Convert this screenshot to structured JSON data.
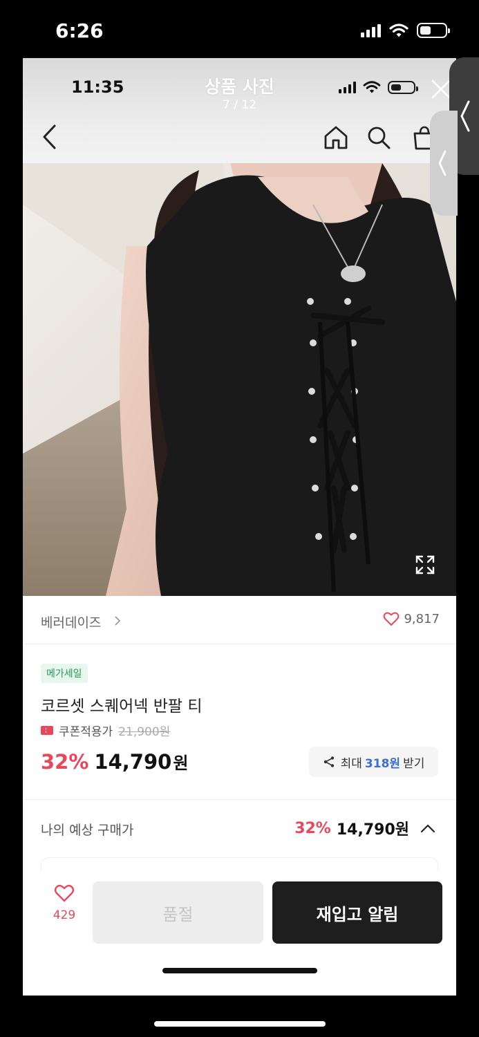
{
  "outer_status": {
    "time": "6:26",
    "icons": [
      "signal-icon",
      "wifi-icon",
      "battery-icon"
    ]
  },
  "inner_status": {
    "time": "11:35",
    "icons": [
      "signal-icon",
      "wifi-icon",
      "battery-icon"
    ]
  },
  "viewer": {
    "title": "상품 사진",
    "counter": "7 / 12"
  },
  "nav": {
    "icons": [
      "back-chevron-icon",
      "home-icon",
      "search-icon",
      "shopping-bag-icon"
    ]
  },
  "photo": {
    "description_icon": "expand-icon"
  },
  "brand": {
    "name": "베러데이즈",
    "chevron": ">",
    "likes": "9,817"
  },
  "product": {
    "badge": "메가세일",
    "name": "코르셋 스퀘어넥 반팔 티",
    "coupon_label": "쿠폰적용가",
    "original_price": "21,900원",
    "discount": "32%",
    "price": "14,790",
    "currency": "원"
  },
  "share": {
    "prefix": "최대",
    "amount": "318원",
    "suffix": "받기"
  },
  "expected": {
    "label": "나의 예상 구매가",
    "discount": "32%",
    "price": "14,790원"
  },
  "bottom": {
    "wish_count": "429",
    "soldout_label": "품절",
    "restock_label": "재입고 알림"
  },
  "colors": {
    "accent_red": "#e8485c",
    "badge_green": "#1f9a55",
    "share_blue": "#3a6fd8",
    "dark_button": "#1e1e1e"
  }
}
